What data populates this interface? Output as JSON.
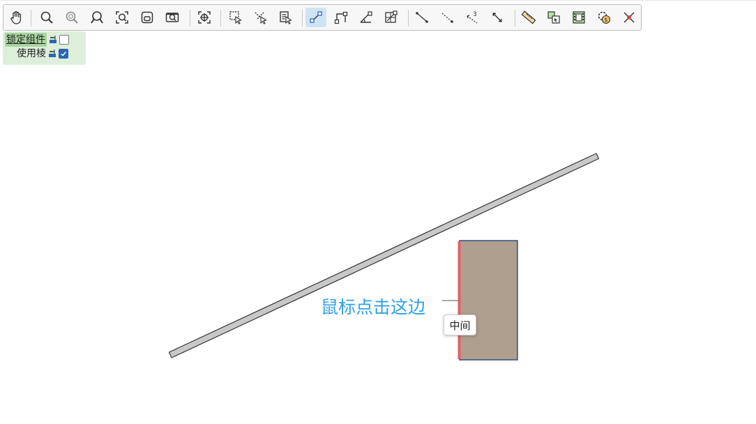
{
  "toolbar": {
    "tools": [
      {
        "name": "pan-icon",
        "title": "平移"
      },
      {
        "name": "zoom-icon",
        "title": "缩放"
      },
      {
        "name": "zoom-window-icon",
        "title": "窗口缩放"
      },
      {
        "name": "zoom-previous-icon",
        "title": "上一视图"
      },
      {
        "name": "zoom-extents-icon",
        "title": "全部显示"
      },
      {
        "name": "zoom-selection-icon",
        "title": "缩放选择"
      },
      {
        "name": "view-camera-icon",
        "title": "视图"
      },
      {
        "name": "orbit-icon",
        "title": "旋转"
      },
      {
        "name": "select-window-icon",
        "title": "框选"
      },
      {
        "name": "select-cross-icon",
        "title": "交叉选择"
      },
      {
        "name": "select-properties-icon",
        "title": "属性选择"
      },
      {
        "name": "snap-endpoint-icon",
        "title": "端点捕捉",
        "active": true
      },
      {
        "name": "snap-corner-icon",
        "title": "角点捕捉"
      },
      {
        "name": "snap-angle-icon",
        "title": "角度捕捉"
      },
      {
        "name": "snap-grid-icon",
        "title": "网格捕捉"
      },
      {
        "name": "line-segment-icon",
        "title": "线段"
      },
      {
        "name": "dashed-line-icon",
        "title": "虚线"
      },
      {
        "name": "three-point-icon",
        "title": "三点"
      },
      {
        "name": "dimension-icon",
        "title": "尺寸"
      },
      {
        "name": "ruler-icon",
        "title": "测量"
      },
      {
        "name": "copy-component-icon",
        "title": "复制构件"
      },
      {
        "name": "component-film-icon",
        "title": "构件"
      },
      {
        "name": "cost-settings-icon",
        "title": "造价设置"
      },
      {
        "name": "delete-point-icon",
        "title": "删除"
      }
    ]
  },
  "options": {
    "lock_label": "锁定组件",
    "lock_checked": false,
    "ridge_label": "使用棱",
    "ridge_checked": true
  },
  "canvas": {
    "hint": "鼠标点击这边",
    "tooltip": "中间",
    "colors": {
      "beam_fill": "#c8c8c8",
      "block_fill": "#ae9f8f",
      "block_border": "#2d4f86",
      "highlight_edge": "#e06068",
      "hint_text": "#2ea0e8"
    }
  }
}
